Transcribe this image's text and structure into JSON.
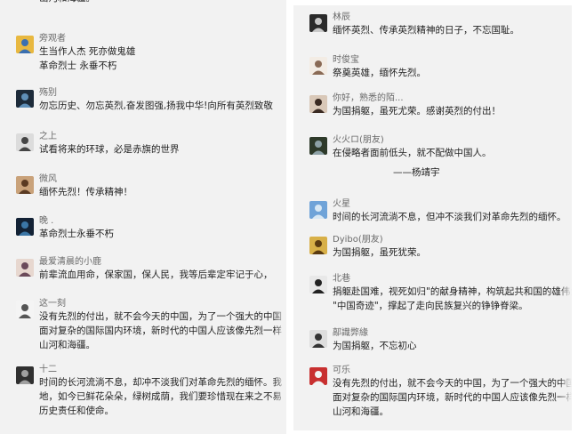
{
  "left": [
    {
      "id": "top",
      "name": "",
      "lines": [
        "山河和海疆。"
      ],
      "avatar": "none"
    },
    {
      "id": "c1",
      "name": "旁观者",
      "lines": [
        "生当作人杰 死亦做鬼雄",
        "革命烈士 永垂不朽"
      ],
      "avatar": "car-avatar-icon",
      "colors": [
        "#e8b840",
        "#3a6fb0"
      ]
    },
    {
      "id": "c2",
      "name": "殇别",
      "lines": [
        "勿忘历史、勿忘英烈,奋发图强,扬我中华!向所有英烈致敬"
      ],
      "avatar": "dark-portrait-avatar-icon",
      "colors": [
        "#1d2b3a",
        "#5f8fb8"
      ]
    },
    {
      "id": "c3",
      "name": "之上",
      "lines": [
        "试看将来的环球，必是赤旗的世界"
      ],
      "avatar": "sketch-avatar-icon",
      "colors": [
        "#dcdcdc",
        "#444"
      ]
    },
    {
      "id": "c4",
      "name": "微风",
      "lines": [
        "缅怀先烈！传承精神！"
      ],
      "avatar": "portrait-avatar-icon",
      "colors": [
        "#c9a27a",
        "#5a3a22"
      ]
    },
    {
      "id": "c5",
      "name": "晚 .",
      "lines": [
        "革命烈士永垂不朽"
      ],
      "avatar": "night-avatar-icon",
      "colors": [
        "#132235",
        "#3b76a6"
      ]
    },
    {
      "id": "c6",
      "name": "最爱清晨的小鹿",
      "lines": [
        "前辈流血用命，保家国，保人民，我等后辈定牢记于心，"
      ],
      "avatar": "anime-avatar-icon",
      "colors": [
        "#e7d7cf",
        "#6b4a5a"
      ]
    },
    {
      "id": "c7",
      "name": "这一刻",
      "lines": [
        "没有先烈的付出，就不会今天的中国，为了一个强大的中国",
        "面对复杂的国际国内环境，新时代的中国人应该像先烈一样",
        "山河和海疆。"
      ],
      "avatar": "cartoon-avatar-icon",
      "colors": [
        "#f4f4f4",
        "#555"
      ]
    },
    {
      "id": "c8",
      "name": "十二",
      "lines": [
        "时间的长河流淌不息，却冲不淡我们对革命先烈的缅怀。我",
        "地，如今已鲜花朵朵，绿树成荫，我们要珍惜现在来之不易",
        "历史责任和使命。"
      ],
      "avatar": "figure-avatar-icon",
      "colors": [
        "#303030",
        "#a0a0a0"
      ]
    }
  ],
  "right": [
    {
      "id": "r1",
      "name": "林辰",
      "lines": [
        "缅怀英烈、传承英烈精神的日子，不忘国耻。"
      ],
      "avatar": "dark-photo-avatar-icon",
      "colors": [
        "#2b2b2b",
        "#c8c8c8"
      ]
    },
    {
      "id": "r2",
      "name": "时俊宝",
      "lines": [
        "祭奠英雄，缅怀先烈。"
      ],
      "avatar": "doll-avatar-icon",
      "colors": [
        "#f3ece4",
        "#8a6a55"
      ]
    },
    {
      "id": "r3",
      "name": "你好，熟悉的陌...",
      "lines": [
        "为国捐躯，虽死尤荣。感谢英烈的付出！"
      ],
      "avatar": "girl-avatar-icon",
      "colors": [
        "#d9c8b8",
        "#3a2a22"
      ]
    },
    {
      "id": "r4",
      "name": "火火ロ(朋友)",
      "lines": [
        "在侵略者面前低头，就不配做中国人。",
        "——杨靖宇"
      ],
      "avatar": "landscape-avatar-icon",
      "colors": [
        "#2e3a2a",
        "#8da1a6"
      ]
    },
    {
      "id": "r5",
      "name": "火星",
      "lines": [
        "时间的长河流淌不息，但冲不淡我们对革命先烈的缅怀。"
      ],
      "avatar": "sky-avatar-icon",
      "colors": [
        "#6fa3d8",
        "#d8e8f4"
      ]
    },
    {
      "id": "r6",
      "name": "Dyibo(朋友)",
      "lines": [
        "为国捐躯，虽死犹荣。"
      ],
      "avatar": "yellow-avatar-icon",
      "colors": [
        "#d8b048",
        "#5a3a10"
      ]
    },
    {
      "id": "r7",
      "name": "北巷",
      "lines": [
        "捐躯赴国难，视死如归\"的献身精神，构筑起共和国的雄伟大",
        "\"中国奇迹\"，撑起了走向民族复兴的铮铮脊梁。"
      ],
      "avatar": "bw-portrait-avatar-icon",
      "colors": [
        "#e8e8e8",
        "#222"
      ]
    },
    {
      "id": "r8",
      "name": "鄗識弊緣",
      "lines": [
        "为国捐躯，不忘初心"
      ],
      "avatar": "sketch2-avatar-icon",
      "colors": [
        "#dedede",
        "#333"
      ]
    },
    {
      "id": "r9",
      "name": "可乐",
      "lines": [
        "没有先烈的付出，就不会今天的中国，为了一个强大的中国，你",
        "面对复杂的国际国内环境，新时代的中国人应该像先烈一样，守",
        "山河和海疆。"
      ],
      "avatar": "red-figure-avatar-icon",
      "colors": [
        "#c83030",
        "#f2f2f2"
      ]
    }
  ]
}
